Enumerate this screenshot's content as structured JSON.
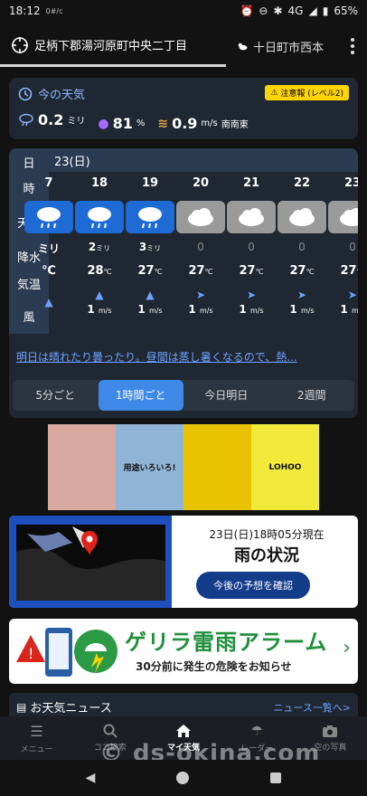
{
  "status": {
    "time": "18:12",
    "extra": "0#/c",
    "network": "4G",
    "battery": "65%"
  },
  "locations": {
    "active": "足柄下郡湯河原町中央二丁目",
    "other": "十日町市西本"
  },
  "current": {
    "title": "今の天気",
    "warning": "注意報 (レベル2)",
    "precip_value": "0.2",
    "precip_unit": "ミリ",
    "humidity_value": "81",
    "humidity_unit": "%",
    "wind_value": "0.9",
    "wind_unit": "m/s",
    "wind_dir": "南南東"
  },
  "forecast": {
    "labels": {
      "day": "日",
      "hour": "時",
      "weather": "天気",
      "precip": "降水",
      "temp": "気温",
      "wind": "風"
    },
    "day": "23(日)",
    "hours": [
      {
        "hour": "7",
        "icon": "rain",
        "precip": "ミリ",
        "temp": "℃",
        "wind": ""
      },
      {
        "hour": "18",
        "icon": "rain",
        "precip": "2",
        "temp": "28",
        "wind": "1"
      },
      {
        "hour": "19",
        "icon": "rain",
        "precip": "3",
        "temp": "27",
        "wind": "1"
      },
      {
        "hour": "20",
        "icon": "cloud",
        "precip": "0",
        "temp": "27",
        "wind": "1"
      },
      {
        "hour": "21",
        "icon": "cloud",
        "precip": "0",
        "temp": "27",
        "wind": "1"
      },
      {
        "hour": "22",
        "icon": "cloud",
        "precip": "0",
        "temp": "27",
        "wind": "1"
      },
      {
        "hour": "23",
        "icon": "cloud",
        "precip": "0",
        "temp": "27",
        "wind": "1"
      }
    ],
    "precip_unit": "ミリ",
    "temp_unit": "℃",
    "wind_unit": "m/s",
    "comment": "明日は晴れたり曇ったり。昼間は蒸し暑くなるので、熱..."
  },
  "interval_tabs": [
    "5分ごと",
    "1時間ごと",
    "今日明日",
    "2週間"
  ],
  "ads": {
    "a2": "用途いろいろ!",
    "a3": "LOHOO"
  },
  "radar": {
    "time": "23日(日)18時05分現在",
    "title": "雨の状況",
    "button": "今後の予想を確認"
  },
  "alarm": {
    "title": "ゲリラ雷雨アラーム",
    "sub": "30分前に発生の危険をお知らせ"
  },
  "news": {
    "title": "お天気ニュース",
    "more": "ニュース一覧へ>"
  },
  "nav": [
    "メニュー",
    "ココ検索",
    "マイ天気",
    "レーダー",
    "空の写真"
  ],
  "watermark": "© ds-okina.com",
  "colors": {
    "accent": "#3f89e9",
    "warning": "#ffd400",
    "rain_icon_bg": "#1e6bd6",
    "alarm_green": "#1f8f3a"
  }
}
